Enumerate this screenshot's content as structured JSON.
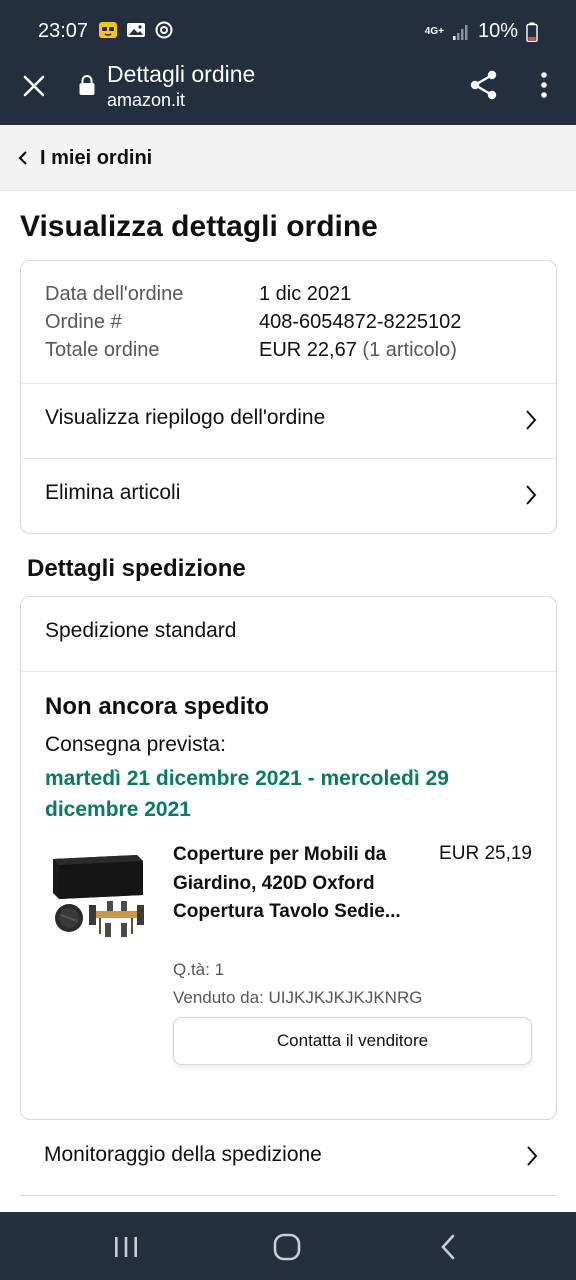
{
  "status_bar": {
    "time": "23:07",
    "network": "4G+",
    "battery": "10%"
  },
  "browser": {
    "title": "Dettagli ordine",
    "url": "amazon.it"
  },
  "breadcrumb": {
    "label": "I miei ordini"
  },
  "page": {
    "title": "Visualizza dettagli ordine"
  },
  "order_summary": {
    "date_label": "Data dell'ordine",
    "date_value": "1 dic 2021",
    "number_label": "Ordine #",
    "number_value": "408-6054872-8225102",
    "total_label": "Totale ordine",
    "total_value": "EUR 22,67",
    "total_items": "(1 articolo)",
    "links": [
      {
        "label": "Visualizza riepilogo dell'ordine"
      },
      {
        "label": "Elimina articoli"
      }
    ]
  },
  "shipping": {
    "section_title": "Dettagli spedizione",
    "method": "Spedizione standard",
    "status": "Non ancora spedito",
    "expected_label": "Consegna prevista:",
    "expected_dates": "martedì 21 dicembre 2021 - mercoledì 29 dicembre 2021",
    "product": {
      "title": "Coperture per Mobili da Giardino, 420D Oxford Copertura Tavolo Sedie...",
      "price": "EUR 25,19",
      "quantity": "Q.tà: 1",
      "seller": "Venduto da: UIJKJKJKJKJKNRG",
      "contact_button": "Contatta il venditore"
    },
    "tracking_label": "Monitoraggio della spedizione"
  },
  "colors": {
    "header_bg": "#232f3e",
    "delivery_green": "#067d62",
    "muted_text": "#565959",
    "border": "#d5d9d9"
  },
  "icons": {
    "close": "close-icon",
    "lock": "lock-icon",
    "share": "share-icon",
    "menu": "more-vert-icon",
    "chevron_left": "chevron-left-icon",
    "chevron_right": "chevron-right-icon"
  }
}
